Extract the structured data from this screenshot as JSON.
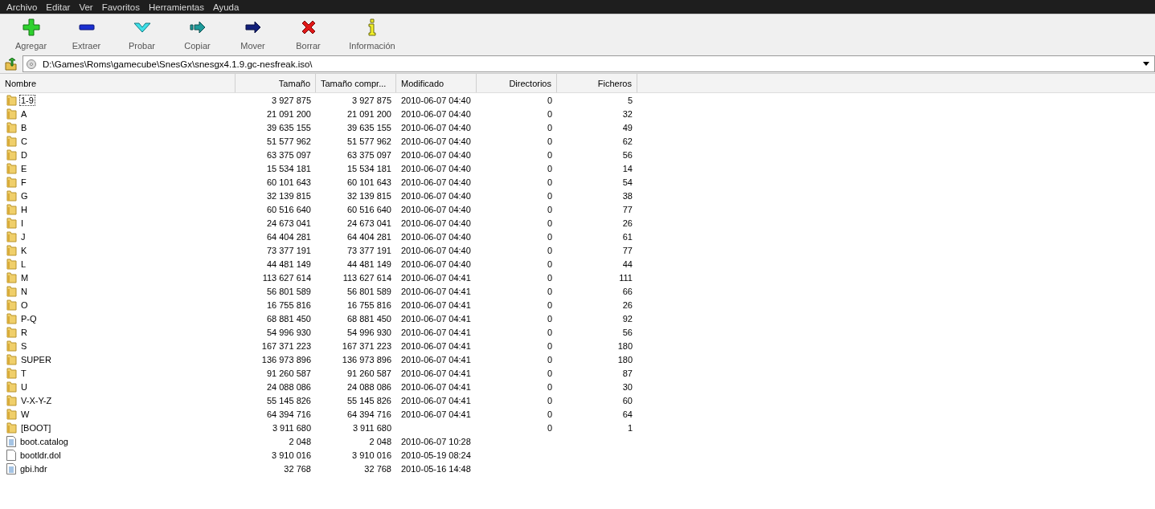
{
  "menu": [
    "Archivo",
    "Editar",
    "Ver",
    "Favoritos",
    "Herramientas",
    "Ayuda"
  ],
  "toolbar": [
    {
      "label": "Agregar",
      "kind": "add"
    },
    {
      "label": "Extraer",
      "kind": "extract"
    },
    {
      "label": "Probar",
      "kind": "test"
    },
    {
      "label": "Copiar",
      "kind": "copy"
    },
    {
      "label": "Mover",
      "kind": "move"
    },
    {
      "label": "Borrar",
      "kind": "delete"
    },
    {
      "label": "Información",
      "kind": "info"
    }
  ],
  "address": {
    "value": "D:\\Games\\Roms\\gamecube\\SnesGx\\snesgx4.1.9.gc-nesfreak.iso\\"
  },
  "columns": [
    "Nombre",
    "Tamaño",
    "Tamaño compr...",
    "Modificado",
    "Directorios",
    "Ficheros"
  ],
  "rows": [
    {
      "kind": "folder",
      "focused": true,
      "name": "1-9",
      "size": "3 927 875",
      "packed": "3 927 875",
      "modified": "2010-06-07 04:40",
      "folders": "0",
      "files": "5"
    },
    {
      "kind": "folder",
      "focused": false,
      "name": "A",
      "size": "21 091 200",
      "packed": "21 091 200",
      "modified": "2010-06-07 04:40",
      "folders": "0",
      "files": "32"
    },
    {
      "kind": "folder",
      "focused": false,
      "name": "B",
      "size": "39 635 155",
      "packed": "39 635 155",
      "modified": "2010-06-07 04:40",
      "folders": "0",
      "files": "49"
    },
    {
      "kind": "folder",
      "focused": false,
      "name": "C",
      "size": "51 577 962",
      "packed": "51 577 962",
      "modified": "2010-06-07 04:40",
      "folders": "0",
      "files": "62"
    },
    {
      "kind": "folder",
      "focused": false,
      "name": "D",
      "size": "63 375 097",
      "packed": "63 375 097",
      "modified": "2010-06-07 04:40",
      "folders": "0",
      "files": "56"
    },
    {
      "kind": "folder",
      "focused": false,
      "name": "E",
      "size": "15 534 181",
      "packed": "15 534 181",
      "modified": "2010-06-07 04:40",
      "folders": "0",
      "files": "14"
    },
    {
      "kind": "folder",
      "focused": false,
      "name": "F",
      "size": "60 101 643",
      "packed": "60 101 643",
      "modified": "2010-06-07 04:40",
      "folders": "0",
      "files": "54"
    },
    {
      "kind": "folder",
      "focused": false,
      "name": "G",
      "size": "32 139 815",
      "packed": "32 139 815",
      "modified": "2010-06-07 04:40",
      "folders": "0",
      "files": "38"
    },
    {
      "kind": "folder",
      "focused": false,
      "name": "H",
      "size": "60 516 640",
      "packed": "60 516 640",
      "modified": "2010-06-07 04:40",
      "folders": "0",
      "files": "77"
    },
    {
      "kind": "folder",
      "focused": false,
      "name": "I",
      "size": "24 673 041",
      "packed": "24 673 041",
      "modified": "2010-06-07 04:40",
      "folders": "0",
      "files": "26"
    },
    {
      "kind": "folder",
      "focused": false,
      "name": "J",
      "size": "64 404 281",
      "packed": "64 404 281",
      "modified": "2010-06-07 04:40",
      "folders": "0",
      "files": "61"
    },
    {
      "kind": "folder",
      "focused": false,
      "name": "K",
      "size": "73 377 191",
      "packed": "73 377 191",
      "modified": "2010-06-07 04:40",
      "folders": "0",
      "files": "77"
    },
    {
      "kind": "folder",
      "focused": false,
      "name": "L",
      "size": "44 481 149",
      "packed": "44 481 149",
      "modified": "2010-06-07 04:40",
      "folders": "0",
      "files": "44"
    },
    {
      "kind": "folder",
      "focused": false,
      "name": "M",
      "size": "113 627 614",
      "packed": "113 627 614",
      "modified": "2010-06-07 04:41",
      "folders": "0",
      "files": "111"
    },
    {
      "kind": "folder",
      "focused": false,
      "name": "N",
      "size": "56 801 589",
      "packed": "56 801 589",
      "modified": "2010-06-07 04:41",
      "folders": "0",
      "files": "66"
    },
    {
      "kind": "folder",
      "focused": false,
      "name": "O",
      "size": "16 755 816",
      "packed": "16 755 816",
      "modified": "2010-06-07 04:41",
      "folders": "0",
      "files": "26"
    },
    {
      "kind": "folder",
      "focused": false,
      "name": "P-Q",
      "size": "68 881 450",
      "packed": "68 881 450",
      "modified": "2010-06-07 04:41",
      "folders": "0",
      "files": "92"
    },
    {
      "kind": "folder",
      "focused": false,
      "name": "R",
      "size": "54 996 930",
      "packed": "54 996 930",
      "modified": "2010-06-07 04:41",
      "folders": "0",
      "files": "56"
    },
    {
      "kind": "folder",
      "focused": false,
      "name": "S",
      "size": "167 371 223",
      "packed": "167 371 223",
      "modified": "2010-06-07 04:41",
      "folders": "0",
      "files": "180"
    },
    {
      "kind": "folder",
      "focused": false,
      "name": "SUPER",
      "size": "136 973 896",
      "packed": "136 973 896",
      "modified": "2010-06-07 04:41",
      "folders": "0",
      "files": "180"
    },
    {
      "kind": "folder",
      "focused": false,
      "name": "T",
      "size": "91 260 587",
      "packed": "91 260 587",
      "modified": "2010-06-07 04:41",
      "folders": "0",
      "files": "87"
    },
    {
      "kind": "folder",
      "focused": false,
      "name": "U",
      "size": "24 088 086",
      "packed": "24 088 086",
      "modified": "2010-06-07 04:41",
      "folders": "0",
      "files": "30"
    },
    {
      "kind": "folder",
      "focused": false,
      "name": "V-X-Y-Z",
      "size": "55 145 826",
      "packed": "55 145 826",
      "modified": "2010-06-07 04:41",
      "folders": "0",
      "files": "60"
    },
    {
      "kind": "folder",
      "focused": false,
      "name": "W",
      "size": "64 394 716",
      "packed": "64 394 716",
      "modified": "2010-06-07 04:41",
      "folders": "0",
      "files": "64"
    },
    {
      "kind": "folder",
      "focused": false,
      "name": "[BOOT]",
      "size": "3 911 680",
      "packed": "3 911 680",
      "folders": "0",
      "files": "1"
    },
    {
      "kind": "text-file",
      "focused": false,
      "name": "boot.catalog",
      "size": "2 048",
      "packed": "2 048",
      "modified": "2010-06-07 10:28"
    },
    {
      "kind": "blank-file",
      "focused": false,
      "name": "bootldr.dol",
      "size": "3 910 016",
      "packed": "3 910 016",
      "modified": "2010-05-19 08:24"
    },
    {
      "kind": "text-file",
      "focused": false,
      "name": "gbi.hdr",
      "size": "32 768",
      "packed": "32 768",
      "modified": "2010-05-16 14:48"
    }
  ]
}
